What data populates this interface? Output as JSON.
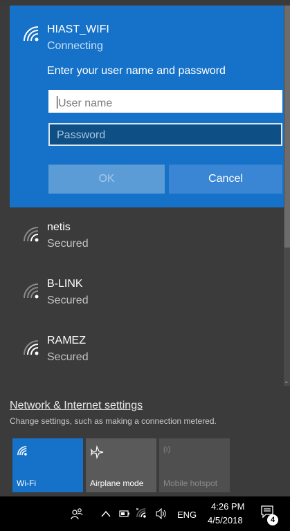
{
  "active_network": {
    "name": "HIAST_WIFI",
    "status": "Connecting",
    "prompt": "Enter your user name and password",
    "username_placeholder": "User name",
    "password_placeholder": "Password",
    "ok_label": "OK",
    "cancel_label": "Cancel"
  },
  "networks": [
    {
      "name": "netis",
      "status": "Secured"
    },
    {
      "name": "B-LINK",
      "status": "Secured"
    },
    {
      "name": "RAMEZ",
      "status": "Secured"
    }
  ],
  "settings": {
    "link": "Network & Internet settings",
    "description": "Change settings, such as making a connection metered."
  },
  "quick_actions": [
    {
      "label": "Wi-Fi",
      "icon": "wifi-icon",
      "state": "on"
    },
    {
      "label": "Airplane mode",
      "icon": "airplane-icon",
      "state": "off"
    },
    {
      "label": "Mobile hotspot",
      "icon": "hotspot-icon",
      "state": "disabled"
    }
  ],
  "taskbar": {
    "language": "ENG",
    "time": "4:26 PM",
    "date": "4/5/2018",
    "notification_count": "4"
  },
  "colors": {
    "accent": "#1672c8",
    "flyout_bg": "#3b3b3b",
    "taskbar_bg": "#000000"
  }
}
